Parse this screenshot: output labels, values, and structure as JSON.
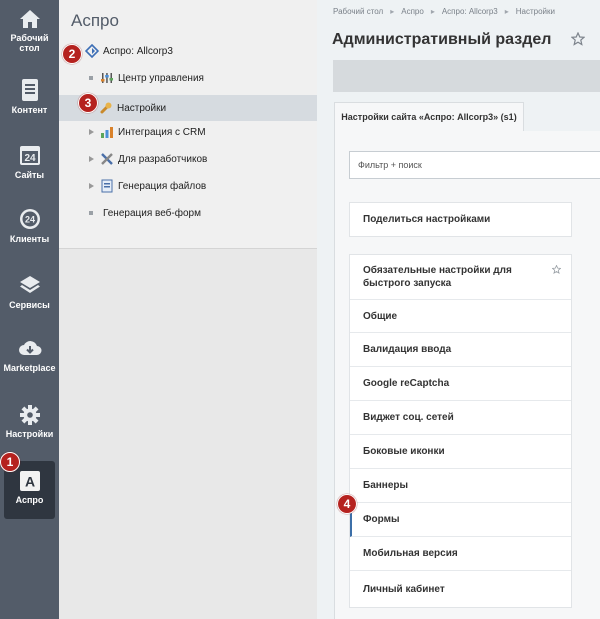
{
  "rail": {
    "items": [
      {
        "label": "Рабочий\nстол",
        "icon": "home-icon"
      },
      {
        "label": "Контент",
        "icon": "document-icon"
      },
      {
        "label": "Сайты",
        "icon": "calendar-icon"
      },
      {
        "label": "Клиенты",
        "icon": "clients-icon"
      },
      {
        "label": "Сервисы",
        "icon": "layers-icon"
      },
      {
        "label": "Marketplace",
        "icon": "cloud-download-icon"
      },
      {
        "label": "Настройки",
        "icon": "gear-icon"
      },
      {
        "label": "Аспро",
        "icon": "letter-a-icon"
      }
    ],
    "calendar_day": "24",
    "clients_badge": "24",
    "aspro_letter": "A"
  },
  "tree": {
    "title": "Аспро",
    "items": [
      {
        "label": "Аспро: Allcorp3"
      },
      {
        "label": "Центр управления"
      },
      {
        "label": "Настройки"
      },
      {
        "label": "Интеграция с CRM"
      },
      {
        "label": "Для разработчиков"
      },
      {
        "label": "Генерация файлов"
      },
      {
        "label": "Генерация веб-форм"
      }
    ]
  },
  "main": {
    "breadcrumbs": [
      "Рабочий стол",
      "Аспро",
      "Аспро: Allcorp3",
      "Настройки"
    ],
    "title": "Административный раздел",
    "tab_label": "Настройки сайта «Аспро: Allcorp3» (s1)",
    "filter_placeholder": "Фильтр + поиск",
    "share_button": "Поделиться настройками",
    "settings_items": [
      "Обязательные настройки для быстрого запуска",
      "Общие",
      "Валидация ввода",
      "Google reCaptcha",
      "Виджет соц. сетей",
      "Боковые иконки",
      "Баннеры",
      "Формы",
      "Мобильная версия",
      "Личный кабинет"
    ]
  },
  "markers": [
    "1",
    "2",
    "3",
    "4"
  ],
  "colors": {
    "rail": "#535c69",
    "rail_active": "#2f3640",
    "marker": "#b5221f",
    "accent": "#3c6fa8"
  }
}
